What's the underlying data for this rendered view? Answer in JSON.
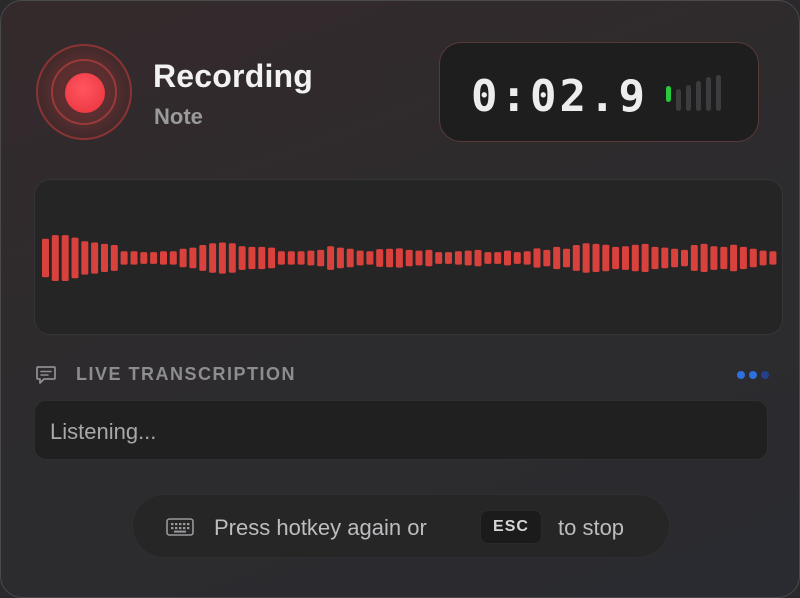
{
  "header": {
    "title": "Recording",
    "subtitle": "Note"
  },
  "timer": {
    "display": "0:02.9",
    "level_bars_total": 6,
    "level_bars_active": 1
  },
  "waveform": {
    "bar_color": "#d8413c",
    "amplitudes": [
      0.52,
      0.62,
      0.62,
      0.55,
      0.45,
      0.42,
      0.38,
      0.35,
      0.18,
      0.18,
      0.16,
      0.16,
      0.18,
      0.18,
      0.25,
      0.28,
      0.35,
      0.4,
      0.42,
      0.4,
      0.32,
      0.3,
      0.3,
      0.28,
      0.18,
      0.18,
      0.18,
      0.2,
      0.22,
      0.32,
      0.28,
      0.25,
      0.2,
      0.18,
      0.24,
      0.25,
      0.26,
      0.22,
      0.2,
      0.22,
      0.16,
      0.16,
      0.18,
      0.2,
      0.22,
      0.16,
      0.16,
      0.2,
      0.16,
      0.18,
      0.26,
      0.22,
      0.3,
      0.25,
      0.35,
      0.4,
      0.38,
      0.36,
      0.3,
      0.32,
      0.36,
      0.38,
      0.3,
      0.28,
      0.25,
      0.22,
      0.35,
      0.38,
      0.32,
      0.3,
      0.36,
      0.3,
      0.25,
      0.2,
      0.18
    ]
  },
  "transcription": {
    "label": "LIVE TRANSCRIPTION",
    "text": "Listening...",
    "dot_colors": [
      "#2f6fe0",
      "#2f6fe0",
      "#25408a"
    ]
  },
  "hint": {
    "before": "Press hotkey again or",
    "key": "ESC",
    "after": "to stop"
  },
  "colors": {
    "accent_red": "#e8323c",
    "level_active": "#27c93f"
  }
}
